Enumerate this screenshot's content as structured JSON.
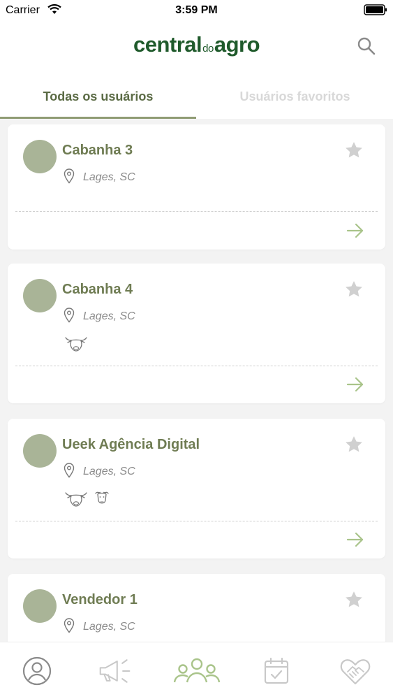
{
  "status_bar": {
    "carrier": "Carrier",
    "time": "3:59 PM"
  },
  "header": {
    "logo_part1": "central",
    "logo_part2": "do",
    "logo_part3": "agro",
    "search_icon": "search-icon"
  },
  "tabs": {
    "all_label": "Todas os usuários",
    "favorites_label": "Usuários favoritos",
    "active": "all"
  },
  "users": [
    {
      "name": "Cabanha 3",
      "location": "Lages, SC",
      "favorite": false,
      "tags": []
    },
    {
      "name": "Cabanha 4",
      "location": "Lages, SC",
      "favorite": false,
      "tags": [
        "cattle-icon"
      ]
    },
    {
      "name": "Ueek Agência Digital",
      "location": "Lages, SC",
      "favorite": false,
      "tags": [
        "cattle-icon",
        "sheep-icon"
      ]
    },
    {
      "name": "Vendedor 1",
      "location": "Lages, SC",
      "favorite": false,
      "tags": []
    }
  ],
  "tab_bar": {
    "items": [
      "profile-icon",
      "megaphone-icon",
      "users-group-icon",
      "calendar-icon",
      "handshake-heart-icon"
    ],
    "active": "users-group-icon"
  },
  "colors": {
    "brand": "#1f5a2b",
    "accent": "#8f9c74",
    "name_text": "#6f7c53",
    "avatar": "#a9b497",
    "star": "#d0d0d0",
    "arrow": "#a9c48a"
  }
}
